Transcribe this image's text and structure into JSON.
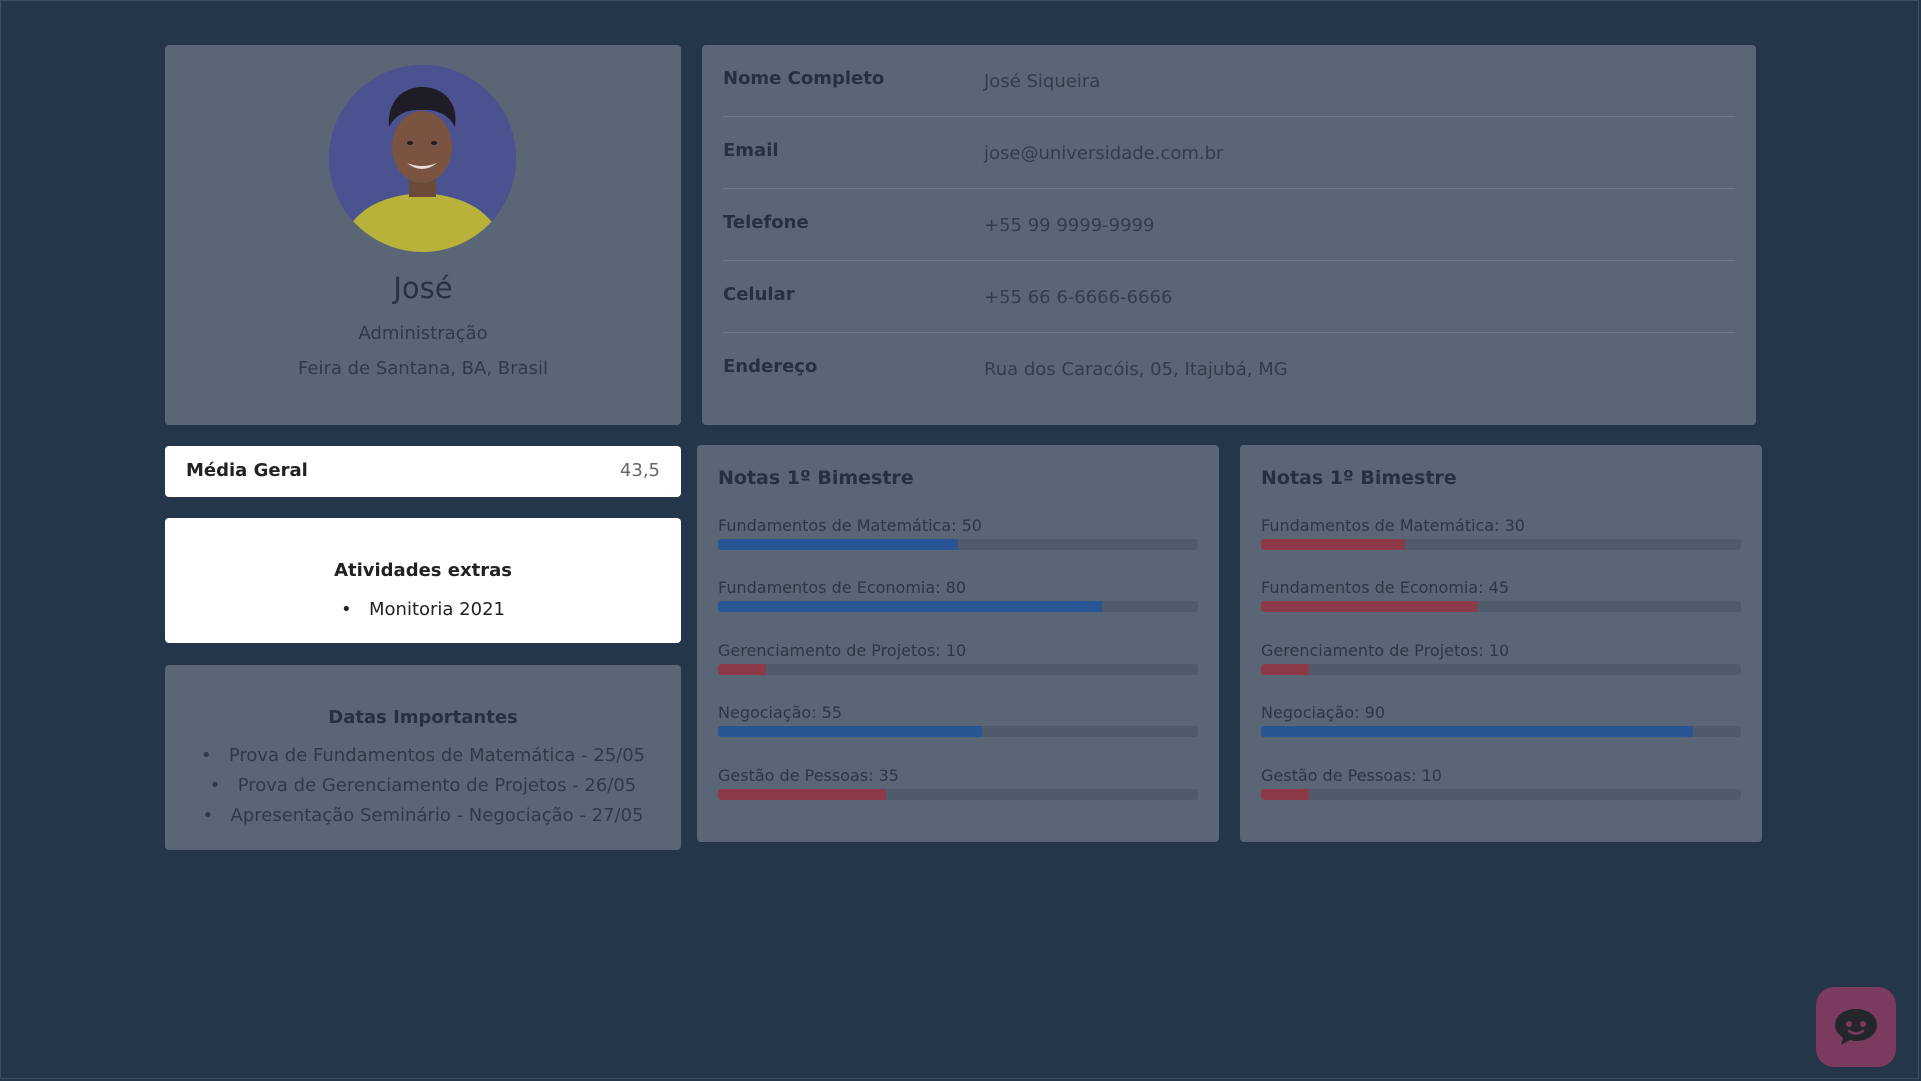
{
  "profile": {
    "name": "José",
    "course": "Administração",
    "location": "Feira de Santana, BA, Brasil"
  },
  "info": [
    {
      "label": "Nome Completo",
      "value": "José Siqueira"
    },
    {
      "label": "Email",
      "value": "jose@universidade.com.br"
    },
    {
      "label": "Telefone",
      "value": "+55 99 9999-9999"
    },
    {
      "label": "Celular",
      "value": "+55 66 6-6666-6666"
    },
    {
      "label": "Endereço",
      "value": "Rua dos Caracóis, 05, Itajubá, MG"
    }
  ],
  "media": {
    "label": "Média Geral",
    "value": "43,5"
  },
  "atividades": {
    "title": "Atividades extras",
    "items": [
      "Monitoria 2021"
    ]
  },
  "datas": {
    "title": "Datas Importantes",
    "items": [
      "Prova de Fundamentos de Matemática - 25/05",
      "Prova de Gerenciamento de Projetos - 26/05",
      "Apresentação Seminário - Negociação - 27/05"
    ]
  },
  "notas": [
    {
      "title": "Notas 1º Bimestre",
      "items": [
        {
          "label": "Fundamentos de Matemática: 50",
          "value": 50
        },
        {
          "label": "Fundamentos de Economia: 80",
          "value": 80
        },
        {
          "label": "Gerenciamento de Projetos: 10",
          "value": 10
        },
        {
          "label": "Negociação: 55",
          "value": 55
        },
        {
          "label": "Gestão de Pessoas: 35",
          "value": 35
        }
      ]
    },
    {
      "title": "Notas 1º Bimestre",
      "items": [
        {
          "label": "Fundamentos de Matemática: 30",
          "value": 30
        },
        {
          "label": "Fundamentos de Economia: 45",
          "value": 45
        },
        {
          "label": "Gerenciamento de Projetos: 10",
          "value": 10
        },
        {
          "label": "Negociação: 90",
          "value": 90
        },
        {
          "label": "Gestão de Pessoas: 10",
          "value": 10
        }
      ]
    }
  ],
  "colors": {
    "bar_pass": "#2a5595",
    "bar_fail": "#8c3a47",
    "overlay_bg": "#25354a"
  },
  "icons": {
    "chat": "chat-bubble-icon"
  }
}
